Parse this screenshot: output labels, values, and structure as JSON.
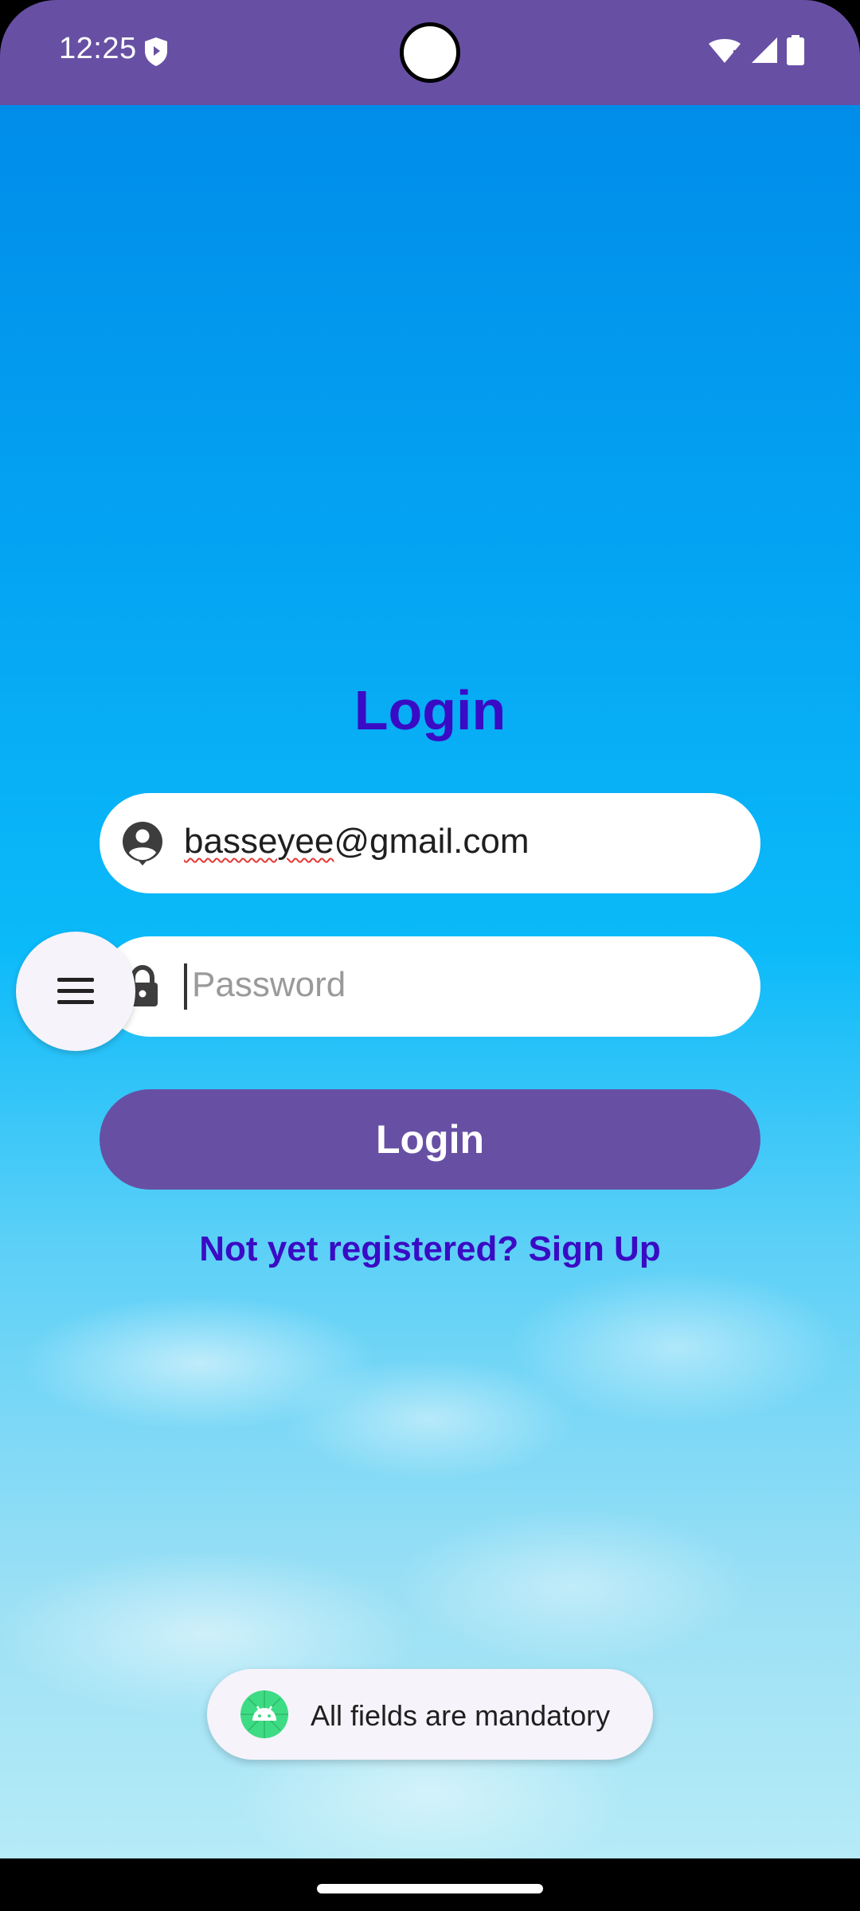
{
  "status_bar": {
    "time": "12:25",
    "icons": [
      "shield-icon",
      "wifi-icon",
      "signal-icon",
      "battery-icon"
    ]
  },
  "login": {
    "title": "Login",
    "email_value": "basseyee@gmail.com",
    "email_misspelled_part": "basseyee",
    "email_rest": "@gmail.com",
    "password_placeholder": "Password",
    "button_label": "Login",
    "signup_text": "Not yet registered? Sign Up"
  },
  "fab": {
    "icon": "menu-icon"
  },
  "toast": {
    "message": "All fields are mandatory",
    "icon": "android-icon"
  },
  "colors": {
    "primary": "#6750A4",
    "title": "#3A0BC4",
    "field_background": "#FFFFFF",
    "spellcheck": "#E53935"
  }
}
